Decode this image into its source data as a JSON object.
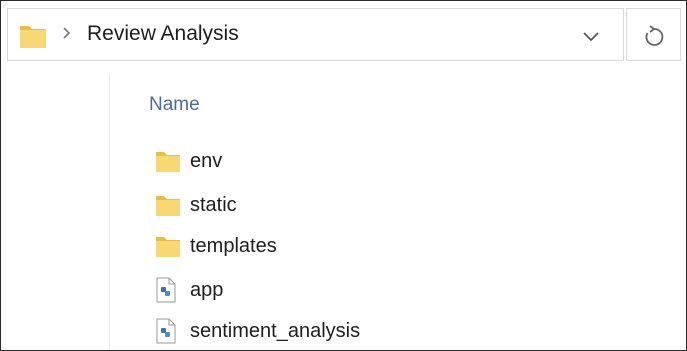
{
  "window": {
    "breadcrumb": {
      "folder_icon": "folder-icon",
      "separator_icon": "chevron-right-icon",
      "current": "Review Analysis"
    },
    "dropdown_icon": "chevron-down-icon",
    "refresh_icon": "refresh-icon"
  },
  "list": {
    "column_header": "Name",
    "items": [
      {
        "name": "env",
        "icon": "folder-icon"
      },
      {
        "name": "static",
        "icon": "folder-icon"
      },
      {
        "name": "templates",
        "icon": "folder-icon"
      },
      {
        "name": "app",
        "icon": "python-file-icon"
      },
      {
        "name": "sentiment_analysis",
        "icon": "python-file-icon"
      }
    ]
  },
  "colors": {
    "folder": "#f8d775",
    "folder_tab": "#e9bd4c",
    "header_text": "#4c6d9a",
    "border": "#d9d9d9"
  }
}
